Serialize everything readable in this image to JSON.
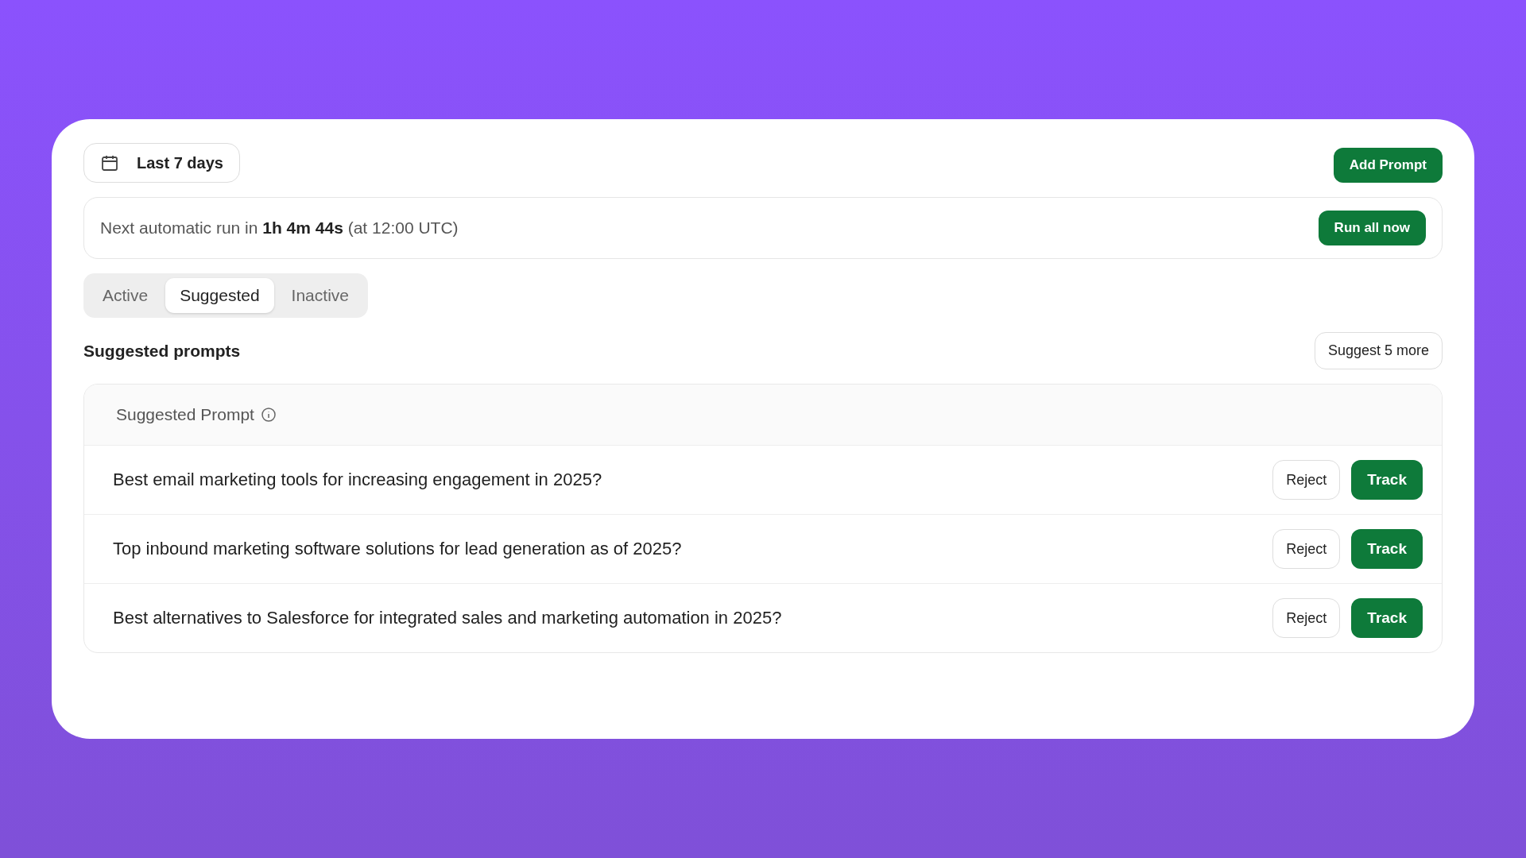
{
  "date_range": {
    "label": "Last 7 days"
  },
  "add_button": "Add Prompt",
  "next_run": {
    "text": "Next automatic run in **1h 4m 44s** (at 12:00 UTC)",
    "button": "Run all now"
  },
  "tabs": [
    {
      "label": "Active",
      "selected": false
    },
    {
      "label": "Suggested",
      "selected": true
    },
    {
      "label": "Inactive",
      "selected": false
    }
  ],
  "section": {
    "title": "Suggested prompts",
    "button": "Suggest 5 more"
  },
  "table": {
    "column": "Suggested Prompt",
    "rows": [
      {
        "prompt": "Best email marketing tools for increasing engagement in 2025?",
        "reject": "Reject",
        "track": "Track"
      },
      {
        "prompt": "Top inbound marketing software solutions for lead generation as of 2025?",
        "reject": "Reject",
        "track": "Track"
      },
      {
        "prompt": "Best alternatives to Salesforce for integrated sales and marketing automation in 2025?",
        "reject": "Reject",
        "track": "Track"
      }
    ]
  }
}
